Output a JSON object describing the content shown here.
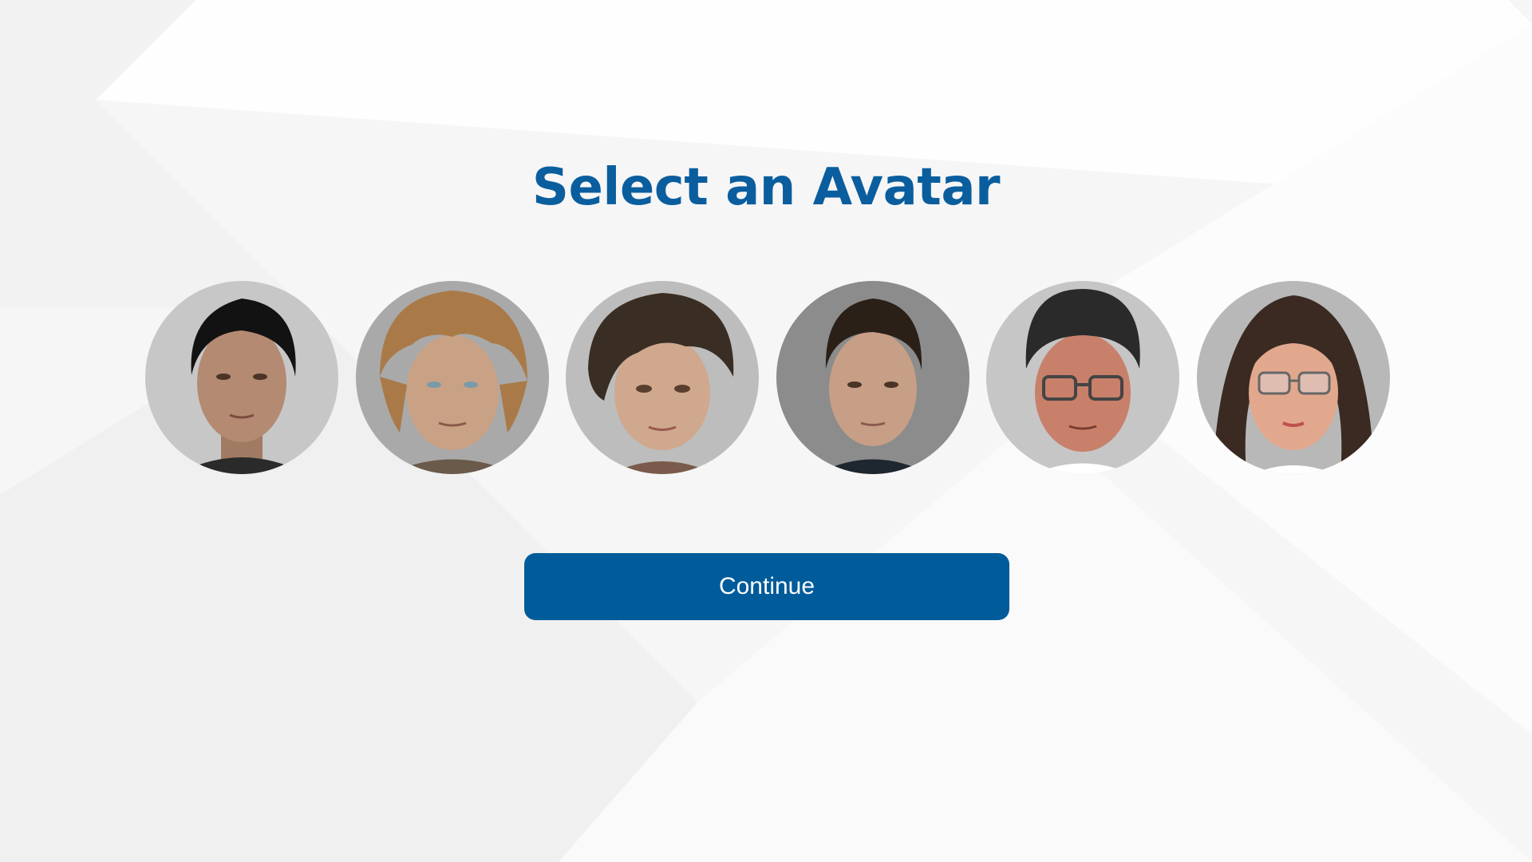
{
  "page": {
    "title": "Select an Avatar"
  },
  "avatars": [
    {
      "name": "avatar-1",
      "hair": "#121212",
      "skin": "#b48a72",
      "bg": "#c7c7c7",
      "glasses": false
    },
    {
      "name": "avatar-2",
      "hair": "#a97a48",
      "skin": "#c9a286",
      "bg": "#a9a9a9",
      "glasses": false
    },
    {
      "name": "avatar-3",
      "hair": "#3a2e24",
      "skin": "#d0a88e",
      "bg": "#bdbdbd",
      "glasses": false
    },
    {
      "name": "avatar-4",
      "hair": "#2a2018",
      "skin": "#c79f86",
      "bg": "#8c8c8c",
      "glasses": false
    },
    {
      "name": "avatar-5",
      "hair": "#2a2a2a",
      "skin": "#c8806a",
      "bg": "#c6c6c6",
      "glasses": true
    },
    {
      "name": "avatar-6",
      "hair": "#3a2a22",
      "skin": "#e2a88e",
      "bg": "#b8b8b8",
      "glasses": true
    }
  ],
  "actions": {
    "continue_label": "Continue"
  },
  "colors": {
    "accent": "#005b9a",
    "title": "#0a5e9e"
  }
}
